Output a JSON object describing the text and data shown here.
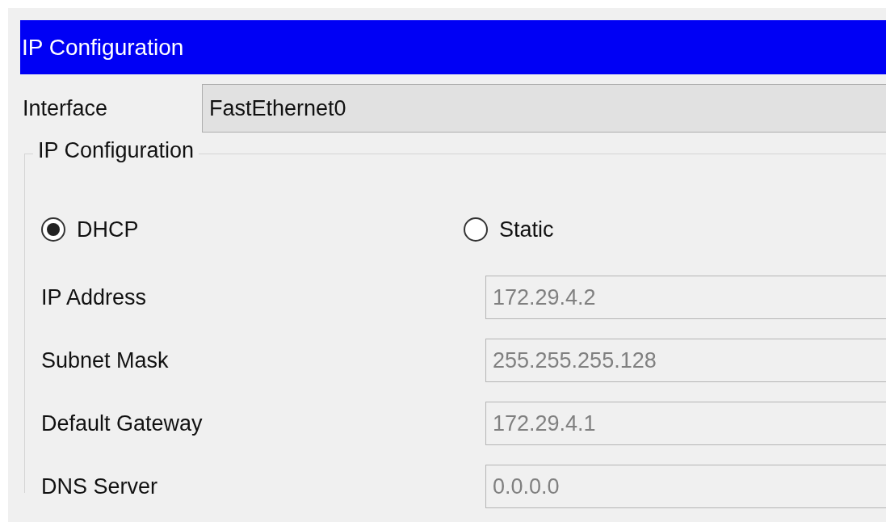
{
  "header": {
    "title": "IP Configuration"
  },
  "interface": {
    "label": "Interface",
    "value": "FastEthernet0"
  },
  "group": {
    "title": "IP Configuration",
    "modes": [
      {
        "label": "DHCP",
        "selected": true
      },
      {
        "label": "Static",
        "selected": false
      }
    ],
    "fields": [
      {
        "label": "IP Address",
        "value": "172.29.4.2",
        "disabled": true
      },
      {
        "label": "Subnet Mask",
        "value": "255.255.255.128",
        "disabled": true
      },
      {
        "label": "Default Gateway",
        "value": "172.29.4.1",
        "disabled": true
      },
      {
        "label": "DNS Server",
        "value": "0.0.0.0",
        "disabled": true
      }
    ]
  }
}
